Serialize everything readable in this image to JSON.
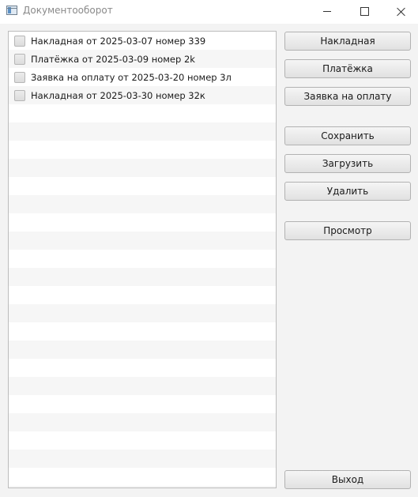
{
  "window": {
    "title": "Документооборот",
    "icon": "app-window-icon"
  },
  "documents": [
    {
      "label": "Накладная от 2025-03-07 номер 339",
      "checked": false
    },
    {
      "label": "Платёжка от 2025-03-09 номер 2k",
      "checked": false
    },
    {
      "label": "Заявка на оплату от 2025-03-20 номер 3л",
      "checked": false
    },
    {
      "label": "Накладная от 2025-03-30 номер 32к",
      "checked": false
    }
  ],
  "buttons": {
    "invoice": "Накладная",
    "payment": "Платёжка",
    "payment_request": "Заявка на оплату",
    "save": "Сохранить",
    "load": "Загрузить",
    "delete": "Удалить",
    "view": "Просмотр",
    "exit": "Выход"
  }
}
